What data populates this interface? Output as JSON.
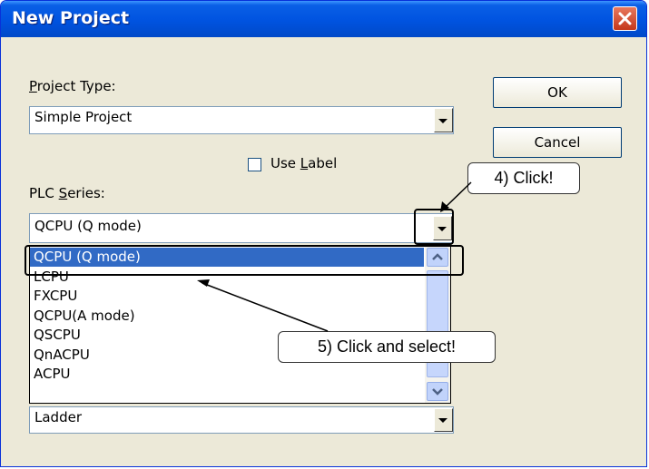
{
  "dialog": {
    "title": "New Project",
    "project_type": {
      "label_u": "P",
      "label_rest": "roject Type:",
      "value": "Simple Project"
    },
    "use_label": {
      "before": "Use ",
      "u": "L",
      "after": "abel",
      "checked": false
    },
    "plc_series": {
      "label_before": "PLC ",
      "label_u": "S",
      "label_rest": "eries:",
      "value": "QCPU (Q mode)"
    },
    "plc_options": [
      "QCPU (Q mode)",
      "LCPU",
      "FXCPU",
      "QCPU(A mode)",
      "QSCPU",
      "QnACPU",
      "ACPU"
    ],
    "selected_option": "QCPU (Q mode)",
    "language": {
      "value": "Ladder"
    },
    "buttons": {
      "ok": "OK",
      "cancel": "Cancel"
    }
  },
  "annotations": {
    "step4": "4) Click!",
    "step5": "5) Click and select!"
  },
  "colors": {
    "title_bar": "#0054e3",
    "selection": "#316ac5",
    "dialog_bg": "#ece9d8",
    "close_button": "#d9542f"
  }
}
